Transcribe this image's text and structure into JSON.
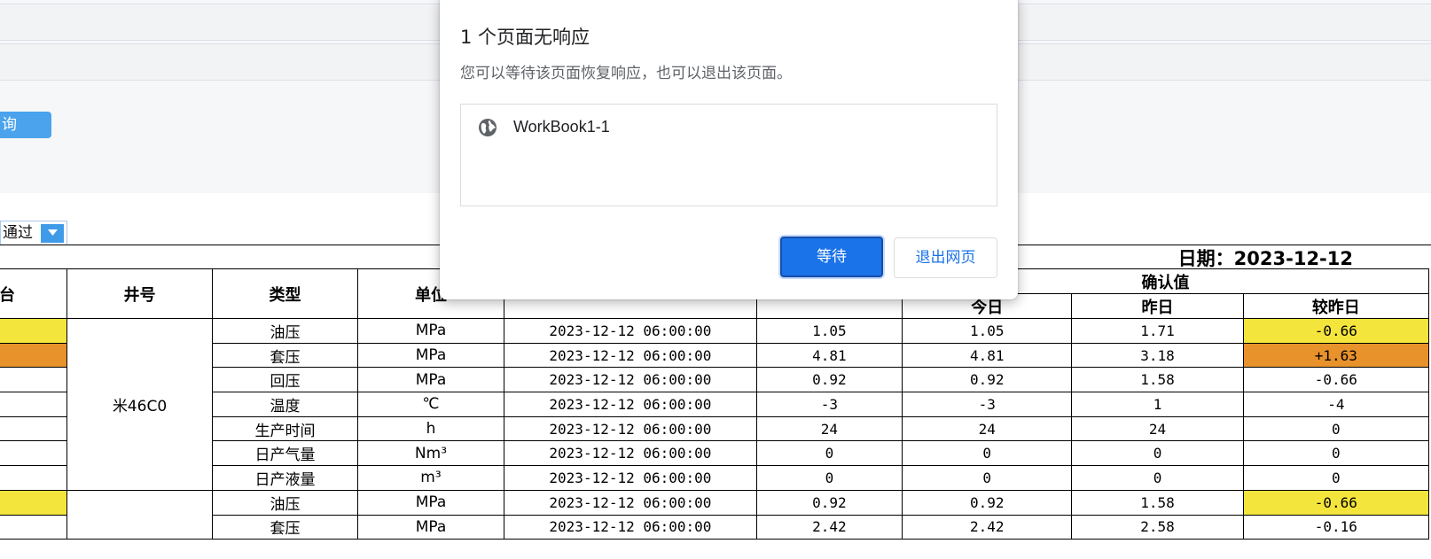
{
  "filter_panel": {
    "query_button": "询",
    "status_select": "通过"
  },
  "report": {
    "date_label": "日期：2023-12-12",
    "headers": {
      "col0": "台",
      "well": "井号",
      "type": "类型",
      "unit": "单位",
      "confirm": "确认值",
      "today": "今日",
      "yesterday": "昨日",
      "diff": "较昨日"
    },
    "group1_well": "米46C0",
    "rows": [
      {
        "type": "油压",
        "unit": "MPa",
        "time": "2023-12-12 06:00:00",
        "value": "1.05",
        "today": "1.05",
        "yesterday": "1.71",
        "diff": "-0.66",
        "hl": "yellow"
      },
      {
        "type": "套压",
        "unit": "MPa",
        "time": "2023-12-12 06:00:00",
        "value": "4.81",
        "today": "4.81",
        "yesterday": "3.18",
        "diff": "+1.63",
        "hl": "orange"
      },
      {
        "type": "回压",
        "unit": "MPa",
        "time": "2023-12-12 06:00:00",
        "value": "0.92",
        "today": "0.92",
        "yesterday": "1.58",
        "diff": "-0.66",
        "hl": ""
      },
      {
        "type": "温度",
        "unit": "℃",
        "time": "2023-12-12 06:00:00",
        "value": "-3",
        "today": "-3",
        "yesterday": "1",
        "diff": "-4",
        "hl": ""
      },
      {
        "type": "生产时间",
        "unit": "h",
        "time": "2023-12-12 06:00:00",
        "value": "24",
        "today": "24",
        "yesterday": "24",
        "diff": "0",
        "hl": ""
      },
      {
        "type": "日产气量",
        "unit": "Nm³",
        "time": "2023-12-12 06:00:00",
        "value": "0",
        "today": "0",
        "yesterday": "0",
        "diff": "0",
        "hl": ""
      },
      {
        "type": "日产液量",
        "unit": "m³",
        "time": "2023-12-12 06:00:00",
        "value": "0",
        "today": "0",
        "yesterday": "0",
        "diff": "0",
        "hl": ""
      },
      {
        "type": "油压",
        "unit": "MPa",
        "time": "2023-12-12 06:00:00",
        "value": "0.92",
        "today": "0.92",
        "yesterday": "1.58",
        "diff": "-0.66",
        "hl": "yellow"
      },
      {
        "type": "套压",
        "unit": "MPa",
        "time": "2023-12-12 06:00:00",
        "value": "2.42",
        "today": "2.42",
        "yesterday": "2.58",
        "diff": "-0.16",
        "hl": ""
      }
    ]
  },
  "dialog": {
    "title": "1 个页面无响应",
    "subtitle": "您可以等待该页面恢复响应，也可以退出该页面。",
    "page_name": "WorkBook1-1",
    "wait_button": "等待",
    "exit_button": "退出网页",
    "globe_icon": "globe-icon"
  },
  "colors": {
    "highlight_yellow": "#f4e53c",
    "highlight_orange": "#e8922c",
    "primary_blue": "#1a73e8",
    "query_blue": "#4aa3ec"
  }
}
